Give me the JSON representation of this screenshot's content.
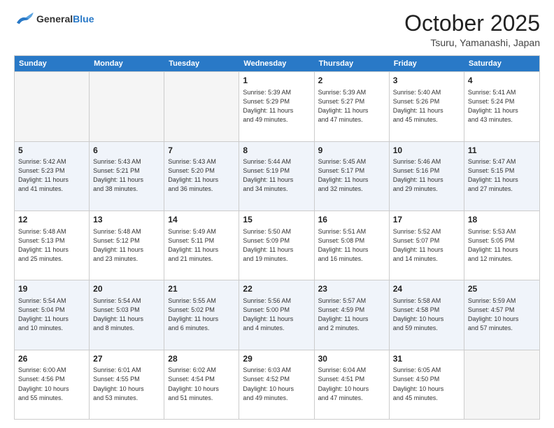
{
  "header": {
    "logo_line1": "General",
    "logo_line2": "Blue",
    "month_title": "October 2025",
    "location": "Tsuru, Yamanashi, Japan"
  },
  "days_of_week": [
    "Sunday",
    "Monday",
    "Tuesday",
    "Wednesday",
    "Thursday",
    "Friday",
    "Saturday"
  ],
  "weeks": [
    [
      {
        "day": "",
        "text": ""
      },
      {
        "day": "",
        "text": ""
      },
      {
        "day": "",
        "text": ""
      },
      {
        "day": "1",
        "text": "Sunrise: 5:39 AM\nSunset: 5:29 PM\nDaylight: 11 hours\nand 49 minutes."
      },
      {
        "day": "2",
        "text": "Sunrise: 5:39 AM\nSunset: 5:27 PM\nDaylight: 11 hours\nand 47 minutes."
      },
      {
        "day": "3",
        "text": "Sunrise: 5:40 AM\nSunset: 5:26 PM\nDaylight: 11 hours\nand 45 minutes."
      },
      {
        "day": "4",
        "text": "Sunrise: 5:41 AM\nSunset: 5:24 PM\nDaylight: 11 hours\nand 43 minutes."
      }
    ],
    [
      {
        "day": "5",
        "text": "Sunrise: 5:42 AM\nSunset: 5:23 PM\nDaylight: 11 hours\nand 41 minutes."
      },
      {
        "day": "6",
        "text": "Sunrise: 5:43 AM\nSunset: 5:21 PM\nDaylight: 11 hours\nand 38 minutes."
      },
      {
        "day": "7",
        "text": "Sunrise: 5:43 AM\nSunset: 5:20 PM\nDaylight: 11 hours\nand 36 minutes."
      },
      {
        "day": "8",
        "text": "Sunrise: 5:44 AM\nSunset: 5:19 PM\nDaylight: 11 hours\nand 34 minutes."
      },
      {
        "day": "9",
        "text": "Sunrise: 5:45 AM\nSunset: 5:17 PM\nDaylight: 11 hours\nand 32 minutes."
      },
      {
        "day": "10",
        "text": "Sunrise: 5:46 AM\nSunset: 5:16 PM\nDaylight: 11 hours\nand 29 minutes."
      },
      {
        "day": "11",
        "text": "Sunrise: 5:47 AM\nSunset: 5:15 PM\nDaylight: 11 hours\nand 27 minutes."
      }
    ],
    [
      {
        "day": "12",
        "text": "Sunrise: 5:48 AM\nSunset: 5:13 PM\nDaylight: 11 hours\nand 25 minutes."
      },
      {
        "day": "13",
        "text": "Sunrise: 5:48 AM\nSunset: 5:12 PM\nDaylight: 11 hours\nand 23 minutes."
      },
      {
        "day": "14",
        "text": "Sunrise: 5:49 AM\nSunset: 5:11 PM\nDaylight: 11 hours\nand 21 minutes."
      },
      {
        "day": "15",
        "text": "Sunrise: 5:50 AM\nSunset: 5:09 PM\nDaylight: 11 hours\nand 19 minutes."
      },
      {
        "day": "16",
        "text": "Sunrise: 5:51 AM\nSunset: 5:08 PM\nDaylight: 11 hours\nand 16 minutes."
      },
      {
        "day": "17",
        "text": "Sunrise: 5:52 AM\nSunset: 5:07 PM\nDaylight: 11 hours\nand 14 minutes."
      },
      {
        "day": "18",
        "text": "Sunrise: 5:53 AM\nSunset: 5:05 PM\nDaylight: 11 hours\nand 12 minutes."
      }
    ],
    [
      {
        "day": "19",
        "text": "Sunrise: 5:54 AM\nSunset: 5:04 PM\nDaylight: 11 hours\nand 10 minutes."
      },
      {
        "day": "20",
        "text": "Sunrise: 5:54 AM\nSunset: 5:03 PM\nDaylight: 11 hours\nand 8 minutes."
      },
      {
        "day": "21",
        "text": "Sunrise: 5:55 AM\nSunset: 5:02 PM\nDaylight: 11 hours\nand 6 minutes."
      },
      {
        "day": "22",
        "text": "Sunrise: 5:56 AM\nSunset: 5:00 PM\nDaylight: 11 hours\nand 4 minutes."
      },
      {
        "day": "23",
        "text": "Sunrise: 5:57 AM\nSunset: 4:59 PM\nDaylight: 11 hours\nand 2 minutes."
      },
      {
        "day": "24",
        "text": "Sunrise: 5:58 AM\nSunset: 4:58 PM\nDaylight: 10 hours\nand 59 minutes."
      },
      {
        "day": "25",
        "text": "Sunrise: 5:59 AM\nSunset: 4:57 PM\nDaylight: 10 hours\nand 57 minutes."
      }
    ],
    [
      {
        "day": "26",
        "text": "Sunrise: 6:00 AM\nSunset: 4:56 PM\nDaylight: 10 hours\nand 55 minutes."
      },
      {
        "day": "27",
        "text": "Sunrise: 6:01 AM\nSunset: 4:55 PM\nDaylight: 10 hours\nand 53 minutes."
      },
      {
        "day": "28",
        "text": "Sunrise: 6:02 AM\nSunset: 4:54 PM\nDaylight: 10 hours\nand 51 minutes."
      },
      {
        "day": "29",
        "text": "Sunrise: 6:03 AM\nSunset: 4:52 PM\nDaylight: 10 hours\nand 49 minutes."
      },
      {
        "day": "30",
        "text": "Sunrise: 6:04 AM\nSunset: 4:51 PM\nDaylight: 10 hours\nand 47 minutes."
      },
      {
        "day": "31",
        "text": "Sunrise: 6:05 AM\nSunset: 4:50 PM\nDaylight: 10 hours\nand 45 minutes."
      },
      {
        "day": "",
        "text": ""
      }
    ]
  ]
}
